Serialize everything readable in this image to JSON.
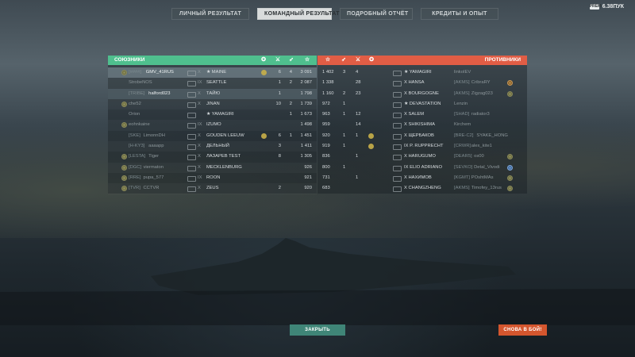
{
  "tabs": [
    {
      "label": "ЛИЧНЫЙ РЕЗУЛЬТАТ",
      "active": false
    },
    {
      "label": "КОМАНДНЫЙ РЕЗУЛЬТАТ",
      "active": true
    },
    {
      "label": "ПОДРОБНЫЙ ОТЧЁТ",
      "active": false
    },
    {
      "label": "КРЕДИТЫ И ОПЫТ",
      "active": false
    }
  ],
  "currency": {
    "icon": "premium-icon",
    "icon_text": "PREM",
    "value": "6.38ПУК"
  },
  "allies": {
    "title": "СОЮЗНИКИ",
    "color": "#4fbf8e",
    "rows": [
      {
        "clan": "[####]",
        "name": "GMV_41RUS",
        "tier": "X",
        "ship": "★ MAINE",
        "c1": "6",
        "c2": "4",
        "exp": "3 091"
      },
      {
        "clan": "",
        "name": "StrobeNOS",
        "tier": "IX",
        "ship": "SEATTLE",
        "c1": "1",
        "c2": "2",
        "exp": "2 087"
      },
      {
        "clan": "[TRIBE]",
        "name": "halford023",
        "tier": "X",
        "ship": "ТАЙЮ",
        "c1": "1",
        "c2": "",
        "exp": "1 798"
      },
      {
        "clan": "",
        "name": "che52",
        "tier": "X",
        "ship": "JINAN",
        "c1": "10",
        "c2": "2",
        "exp": "1 739"
      },
      {
        "clan": "",
        "name": "Orion",
        "tier": "",
        "ship": "★ YAMAGIRI",
        "c1": "",
        "c2": "1",
        "exp": "1 673"
      },
      {
        "clan": "",
        "name": "eohnkaine",
        "tier": "IX",
        "ship": "IZUMO",
        "c1": "",
        "c2": "",
        "exp": "1 498"
      },
      {
        "clan": "[SKE]",
        "name": "LimonnDH",
        "tier": "X",
        "ship": "GOUDEN LEEUW",
        "c1": "6",
        "c2": "1",
        "exp": "1 451"
      },
      {
        "clan": "[H-KY3]",
        "name": "aaaapp",
        "tier": "X",
        "ship": "ДЕЛЬНЫЙ",
        "c1": "3",
        "c2": "",
        "exp": "1 411"
      },
      {
        "clan": "[LESTA]",
        "name": "Tiger",
        "tier": "X",
        "ship": "ЛАЗАРЕВ TEST",
        "c1": "8",
        "c2": "",
        "exp": "1 305"
      },
      {
        "clan": "[DGC]",
        "name": "viermaton",
        "tier": "X",
        "ship": "MECKLENBURG",
        "c1": "",
        "c2": "",
        "exp": "926"
      },
      {
        "clan": "[RRE]",
        "name": "pupa_577",
        "tier": "IX",
        "ship": "ROON",
        "c1": "",
        "c2": "",
        "exp": "921"
      },
      {
        "clan": "[TVR]",
        "name": "CCTVR",
        "tier": "X",
        "ship": "ZEUS",
        "c1": "2",
        "c2": "",
        "exp": "920"
      }
    ]
  },
  "enemies": {
    "title": "ПРОТИВНИКИ",
    "color": "#e15d45",
    "rows": [
      {
        "exp": "1 402",
        "c1": "3",
        "c2": "4",
        "ship": "★ YAMAGIRI",
        "clan": "",
        "name": "linkoIEV"
      },
      {
        "exp": "1 338",
        "c1": "",
        "c2": "28",
        "ship": "X HANSA",
        "clan": "[AKMS]",
        "name": "CribraRY"
      },
      {
        "exp": "1 160",
        "c1": "2",
        "c2": "23",
        "ship": "X BOURGOGNE",
        "clan": "[AKMS]",
        "name": "Zigzag023"
      },
      {
        "exp": "972",
        "c1": "1",
        "c2": "",
        "ship": "★ DEVASTATION",
        "clan": "",
        "name": "Lenzin"
      },
      {
        "exp": "963",
        "c1": "1",
        "c2": "12",
        "ship": "X SALEM",
        "clan": "[SHAD]",
        "name": "radiator3"
      },
      {
        "exp": "959",
        "c1": "",
        "c2": "14",
        "ship": "X SHIKISHIMA",
        "clan": "",
        "name": "Kirchem"
      },
      {
        "exp": "920",
        "c1": "1",
        "c2": "1",
        "ship": "X ЩЕРБАКОВ",
        "clan": "[BRE-C2]",
        "name": "SYAKE_HONG"
      },
      {
        "exp": "919",
        "c1": "1",
        "c2": "",
        "ship": "IX P. RUPPRECHT",
        "clan": "[CRWR]",
        "name": "alex_kite1"
      },
      {
        "exp": "836",
        "c1": "",
        "c2": "1",
        "ship": "X HARUGUMO",
        "clan": "[DEAR5]",
        "name": "os00"
      },
      {
        "exp": "800",
        "c1": "1",
        "c2": "",
        "ship": "IX ELIO ADRIANO",
        "clan": "[SEVKO]",
        "name": "Detal_Vivodi"
      },
      {
        "exp": "731",
        "c1": "",
        "c2": "1",
        "ship": "X НАХИМОВ",
        "clan": "[KGMT]",
        "name": "POshtMAs"
      },
      {
        "exp": "683",
        "c1": "",
        "c2": "",
        "ship": "X CHANGZHENG",
        "clan": "[AKMS]",
        "name": "Timofey_13rus"
      }
    ]
  },
  "buttons": {
    "close": "ЗАКРЫТЬ",
    "again": "СНОВА В БОЙ!"
  }
}
